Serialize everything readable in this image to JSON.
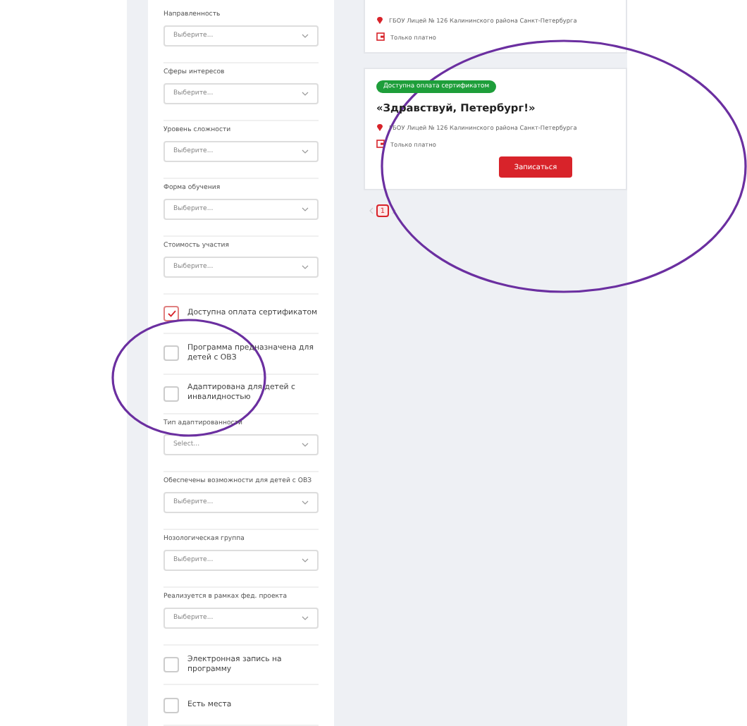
{
  "filters": [
    {
      "kind": "select",
      "label": "Направленность",
      "placeholder": "Выберите..."
    },
    {
      "kind": "select",
      "label": "Сферы интересов",
      "placeholder": "Выберите..."
    },
    {
      "kind": "select",
      "label": "Уровень сложности",
      "placeholder": "Выберите..."
    },
    {
      "kind": "select",
      "label": "Форма обучения",
      "placeholder": "Выберите..."
    },
    {
      "kind": "select",
      "label": "Стоимость участия",
      "placeholder": "Выберите..."
    },
    {
      "kind": "checkbox",
      "label": "Доступна оплата сертификатом",
      "checked": true
    },
    {
      "kind": "checkbox",
      "label": "Программа предназначена для детей с ОВЗ",
      "checked": false
    },
    {
      "kind": "checkbox",
      "label": "Адаптирована для детей с инвалидностью",
      "checked": false
    },
    {
      "kind": "select",
      "label": "Тип адаптированности",
      "placeholder": "Select..."
    },
    {
      "kind": "select",
      "label": "Обеспечены возможности для детей с ОВЗ",
      "placeholder": "Выберите..."
    },
    {
      "kind": "select",
      "label": "Нозологическая группа",
      "placeholder": "Выберите..."
    },
    {
      "kind": "select",
      "label": "Реализуется в рамках фед. проекта",
      "placeholder": "Выберите..."
    },
    {
      "kind": "checkbox",
      "label": "Электронная запись на программу",
      "checked": false
    },
    {
      "kind": "checkbox",
      "label": "Есть места",
      "checked": false
    }
  ],
  "cards": [
    {
      "address": "ГБОУ Лицей № 126 Калининского района Санкт-Петербурга",
      "price": "Только платно"
    },
    {
      "badge": "Доступна оплата сертификатом",
      "title": "«Здравствуй, Петербург!»",
      "address": "ГБОУ Лицей № 126 Калининского района Санкт-Петербурга",
      "price": "Только платно",
      "button": "Записаться"
    }
  ],
  "pagination": {
    "pages": [
      {
        "label": "1",
        "selected": true
      }
    ]
  }
}
